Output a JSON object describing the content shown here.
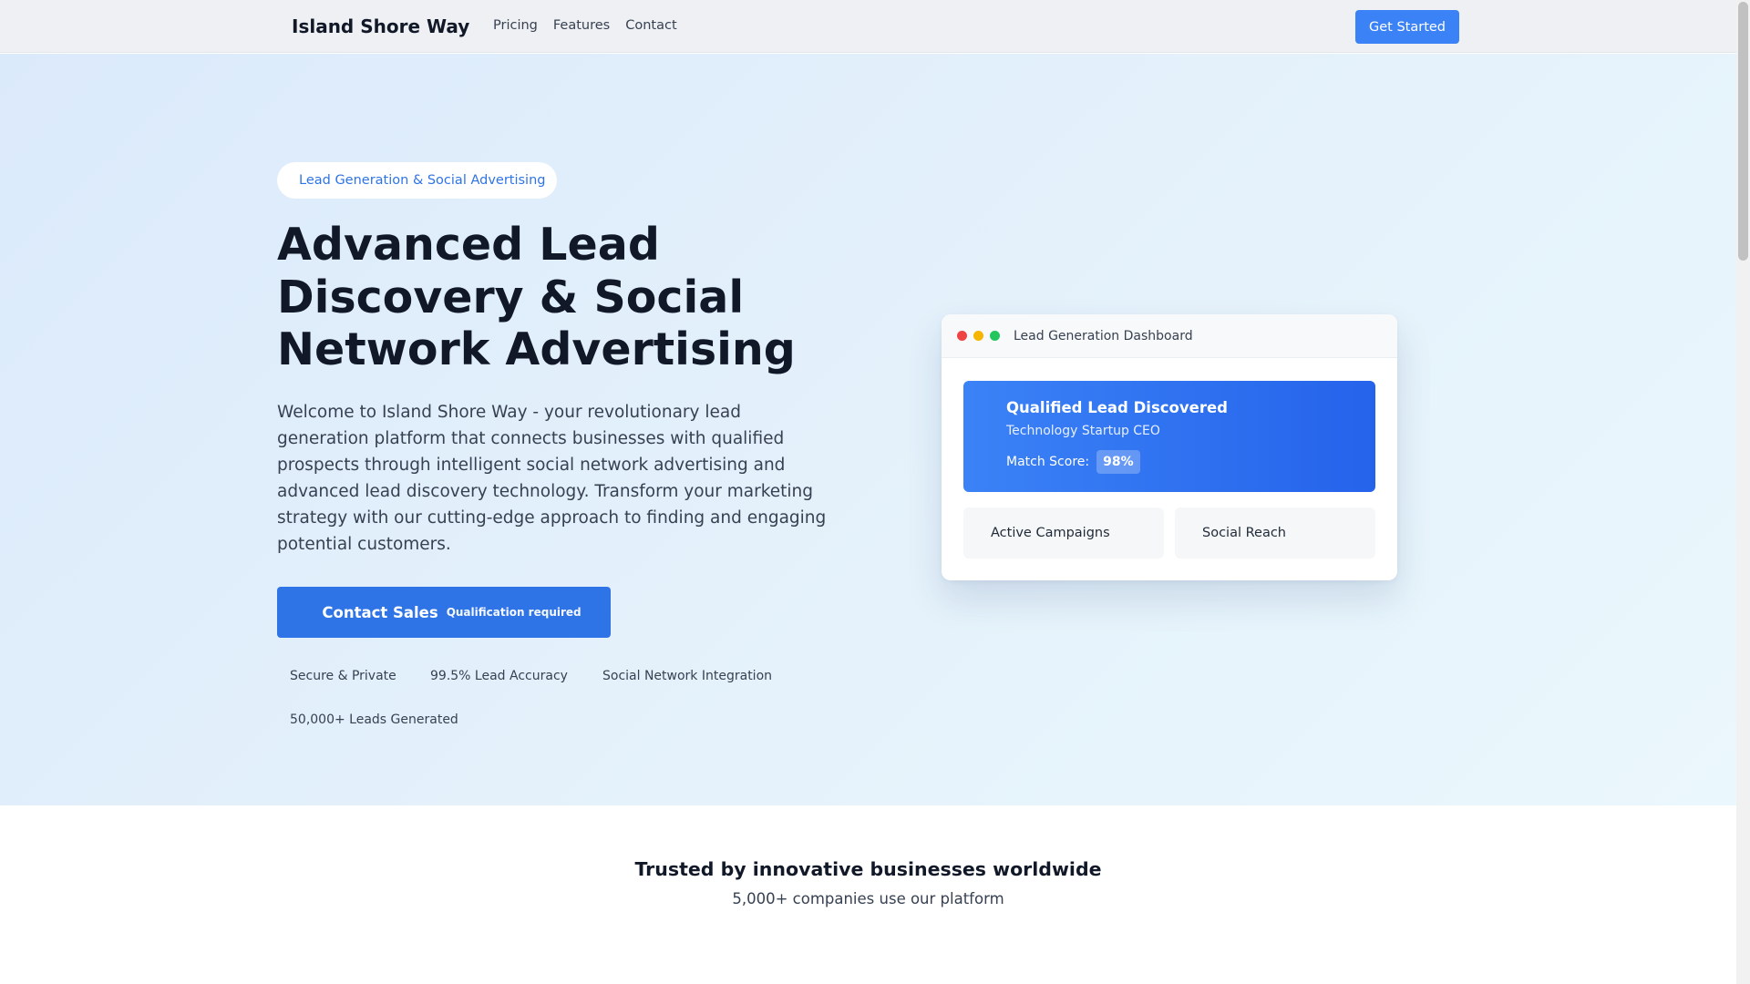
{
  "nav": {
    "brand": "Island Shore Way",
    "brand_icon": "",
    "links": [
      "Pricing",
      "Features",
      "Contact"
    ],
    "cta": "Get Started"
  },
  "hero": {
    "badge_icon": "",
    "badge": "Lead Generation & Social Advertising",
    "title_lines": [
      "Advanced Lead",
      "Discovery & Social",
      "Network Advertising"
    ],
    "description": "Welcome to Island Shore Way - your revolutionary lead generation platform that connects businesses with qualified prospects through intelligent social network advertising and advanced lead discovery technology. Transform your marketing strategy with our cutting-edge approach to finding and engaging potential customers.",
    "button_icon": "",
    "button_label": "Contact Sales",
    "button_sublabel": "Qualification required",
    "features": [
      {
        "icon": "",
        "label": "Secure & Private"
      },
      {
        "icon": "",
        "label": "99.5% Lead Accuracy"
      },
      {
        "icon": "",
        "label": "Social Network Integration"
      },
      {
        "icon": "",
        "label": "50,000+ Leads Generated"
      }
    ]
  },
  "dashboard": {
    "title": "Lead Generation Dashboard",
    "lead": {
      "icon": "",
      "title": "Qualified Lead Discovered",
      "subtitle": "Technology Startup CEO",
      "score_label": "Match Score:",
      "score_value": "98%"
    },
    "stats": [
      {
        "icon": "",
        "label": "Active Campaigns"
      },
      {
        "icon": "",
        "label": "Social Reach"
      }
    ]
  },
  "trusted": {
    "title": "Trusted by innovative businesses worldwide",
    "subtitle": "5,000+ companies use our platform",
    "logo_glyphs": [
      "",
      "",
      "",
      "",
      "",
      ""
    ]
  },
  "colors": {
    "accent": "#3b82f6",
    "accent_dark": "#2563eb",
    "dot_red": "#ef4444",
    "dot_yellow": "#f6b500",
    "dot_green": "#22c55e"
  }
}
